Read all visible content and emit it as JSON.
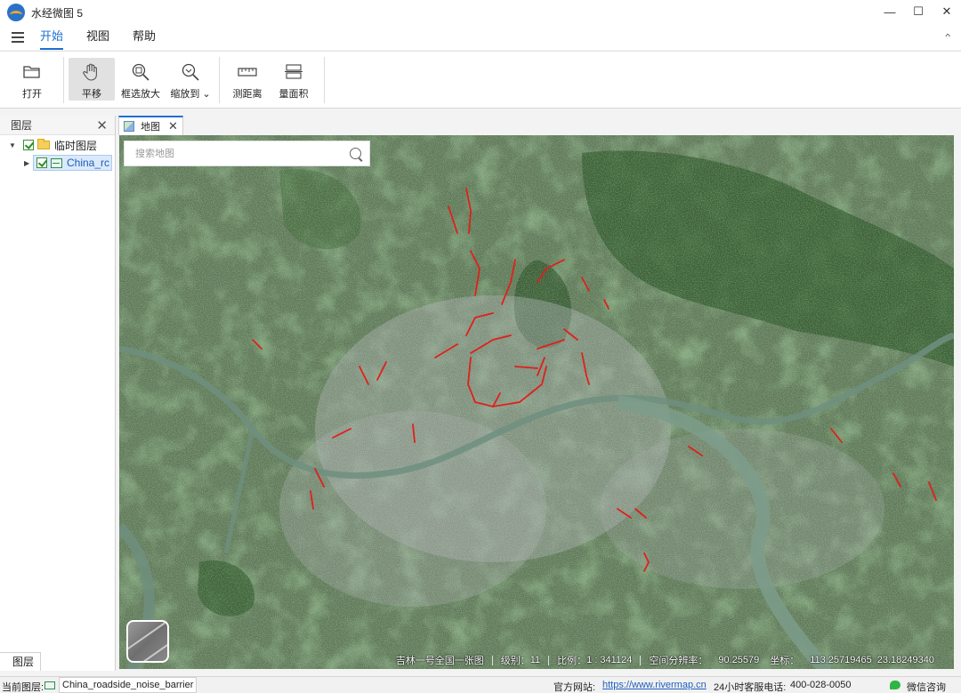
{
  "window": {
    "title": "水经微图 5",
    "minimize": "—",
    "maximize": "☐",
    "close": "✕"
  },
  "menu": {
    "tabs": [
      "开始",
      "视图",
      "帮助"
    ],
    "active_tab": "开始",
    "collapse": "^"
  },
  "ribbon": {
    "buttons": [
      {
        "label": "打开",
        "icon": "folder-open-icon"
      },
      {
        "label": "平移",
        "icon": "hand-pan-icon",
        "active": true
      },
      {
        "label": "框选放大",
        "icon": "zoom-box-icon"
      },
      {
        "label": "缩放到",
        "icon": "zoom-to-icon"
      },
      {
        "label": "测距离",
        "icon": "ruler-icon"
      },
      {
        "label": "量面积",
        "icon": "area-measure-icon"
      }
    ],
    "zoom_to_dropdown": "⌄"
  },
  "layer_panel": {
    "title": "图层",
    "close": "✕",
    "tree": {
      "group_label": "临时图层",
      "group_checked": true,
      "layer_label": "China_rc",
      "layer_checked": true
    },
    "bottom_tab": "图层"
  },
  "document_tab": {
    "label": "地图",
    "close": "✕"
  },
  "map": {
    "search_placeholder": "搜索地图",
    "basemap_name": "satellite-imagery",
    "status": {
      "source": "吉林一号全国一张图",
      "level_label": "级别：",
      "level": "11",
      "scale_label": "比例：",
      "scale": "1 : 341124",
      "resolution_label": "空间分辨率：",
      "resolution": "90.25579",
      "coord_label": "坐标：",
      "coord_x": "113.25719465",
      "coord_y": "23.18249340"
    },
    "colors": {
      "vegetation": "#3f6a35",
      "urban": "#8e9a96",
      "river": "#7a9a8a",
      "road_highlight": "#e0201a"
    }
  },
  "status_bar": {
    "current_layer_label": "当前图层:",
    "current_layer": "China_roadside_noise_barrier",
    "website_label": "官方网站:",
    "website_url": "https://www.rivermap.cn",
    "hotline_label": "24小时客服电话:",
    "hotline": "400-028-0050",
    "wechat": "微信咨询"
  }
}
